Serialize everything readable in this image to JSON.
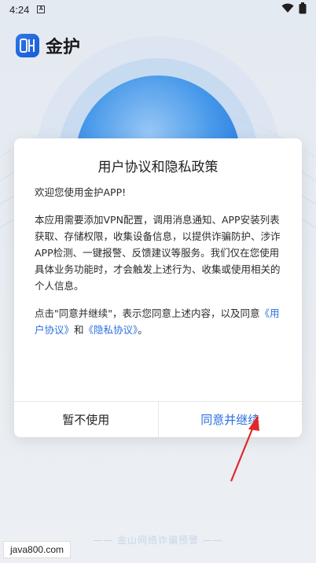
{
  "status_bar": {
    "time": "4:24",
    "notification_badge": "A",
    "icons": [
      "wifi-icon",
      "battery-icon"
    ]
  },
  "app": {
    "name": "金护",
    "logo_letters": "QH",
    "accent_color": "#2c6fe0"
  },
  "dialog": {
    "title": "用户协议和隐私政策",
    "greeting": "欢迎您使用金护APP!",
    "paragraph1": "本应用需要添加VPN配置，调用消息通知、APP安装列表获取、存储权限，收集设备信息，以提供诈骗防护、涉诈APP检测、一键报警、反馈建议等服务。我们仅在您使用具体业务功能时，才会触发上述行为、收集或使用相关的个人信息。",
    "paragraph2_prefix": "点击\"同意并继续\"，表示您同意上述内容，以及同意",
    "user_agreement_link": "《用户协议》",
    "paragraph2_middle": "和",
    "privacy_link": "《隐私协议》",
    "paragraph2_suffix": "。",
    "decline_label": "暂不使用",
    "accept_label": "同意并继续"
  },
  "footer": {
    "slogan": "—— 金山网络诈骗预警 ——",
    "watermark": "java800.com"
  }
}
